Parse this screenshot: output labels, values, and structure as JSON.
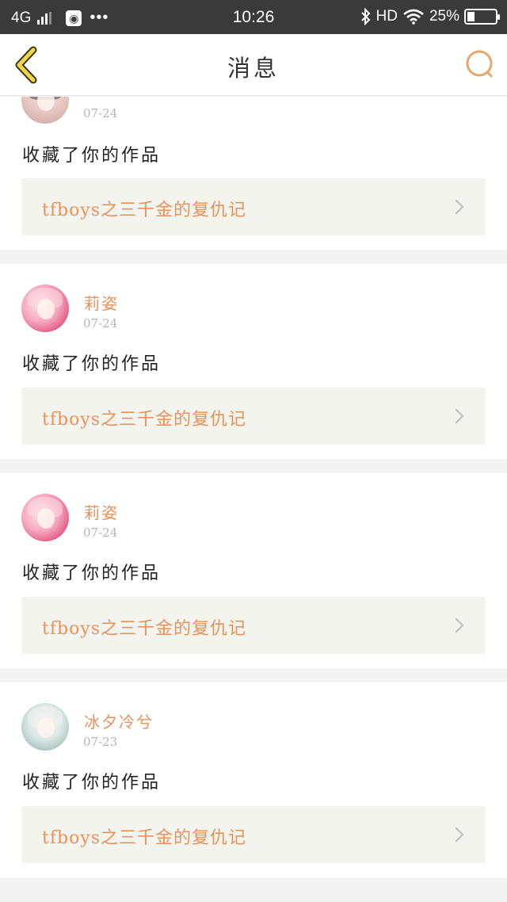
{
  "status_bar": {
    "network": "4G",
    "time": "10:26",
    "hd": "HD",
    "battery_percent_text": "25%",
    "battery_level": 0.25,
    "icons": [
      "signal-icon",
      "globe-icon",
      "more-dots-icon",
      "bluetooth-icon",
      "wifi-icon",
      "battery-icon"
    ]
  },
  "header": {
    "title": "消息",
    "back_icon": "chevron-left-icon",
    "search_icon": "search-icon",
    "accent_color": "#e8925b",
    "back_color": "#f3d54a"
  },
  "messages": [
    {
      "user": "",
      "date": "07-24",
      "action": "收藏了你的作品",
      "work_title": "tfboys之三千金的复仇记",
      "avatar": "anime-girl-avatar"
    },
    {
      "user": "莉姿",
      "date": "07-24",
      "action": "收藏了你的作品",
      "work_title": "tfboys之三千金的复仇记",
      "avatar": "pink-anime-avatar"
    },
    {
      "user": "莉姿",
      "date": "07-24",
      "action": "收藏了你的作品",
      "work_title": "tfboys之三千金的复仇记",
      "avatar": "pink-anime-avatar"
    },
    {
      "user": "冰夕冷兮",
      "date": "07-23",
      "action": "收藏了你的作品",
      "work_title": "tfboys之三千金的复仇记",
      "avatar": "white-hair-anime-avatar"
    }
  ]
}
